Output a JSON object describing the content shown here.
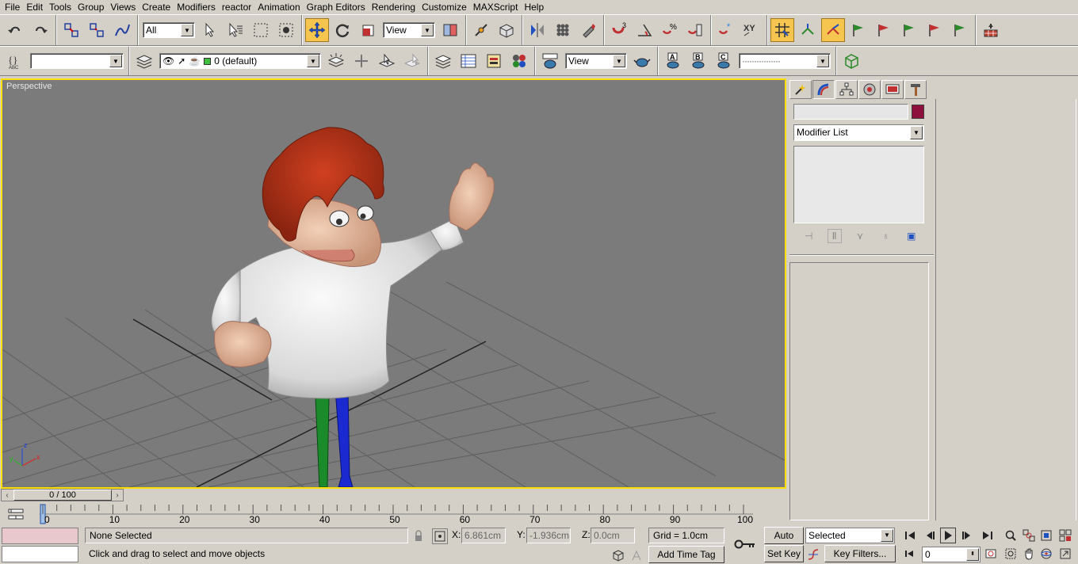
{
  "menu": [
    "File",
    "Edit",
    "Tools",
    "Group",
    "Views",
    "Create",
    "Modifiers",
    "reactor",
    "Animation",
    "Graph Editors",
    "Rendering",
    "Customize",
    "MAXScript",
    "Help"
  ],
  "toolbar": {
    "filter_value": "All",
    "refcoord_value": "View",
    "layer_value": "0 (default)",
    "render_view_value": "View",
    "named_sel_value": "",
    "line_style_value": "················"
  },
  "viewport": {
    "label": "Perspective"
  },
  "command_panel": {
    "modifier_list": "Modifier List",
    "object_color": "#8e0f3b"
  },
  "time_slider": {
    "label": "0 / 100",
    "frame_fraction": 0.0
  },
  "trackbar": {
    "ticks": [
      "0",
      "10",
      "20",
      "30",
      "40",
      "50",
      "60",
      "70",
      "80",
      "90",
      "100"
    ]
  },
  "status": {
    "selection": "None Selected",
    "prompt": "Click and drag to select and move objects",
    "x_label": "X:",
    "x_value": "6.861cm",
    "y_label": "Y:",
    "y_value": "-1.936cm",
    "z_label": "Z:",
    "z_value": "0.0cm",
    "grid": "Grid = 1.0cm",
    "add_time_tag": "Add Time Tag",
    "auto_key": "Auto Key",
    "set_key": "Set Key",
    "selected_dd": "Selected",
    "key_filters": "Key Filters...",
    "frame_value": "0"
  },
  "colors": {
    "viewport_border": "#ffde00",
    "active_tool": "#f6c54f",
    "viewport_bg": "#7b7b7b"
  }
}
